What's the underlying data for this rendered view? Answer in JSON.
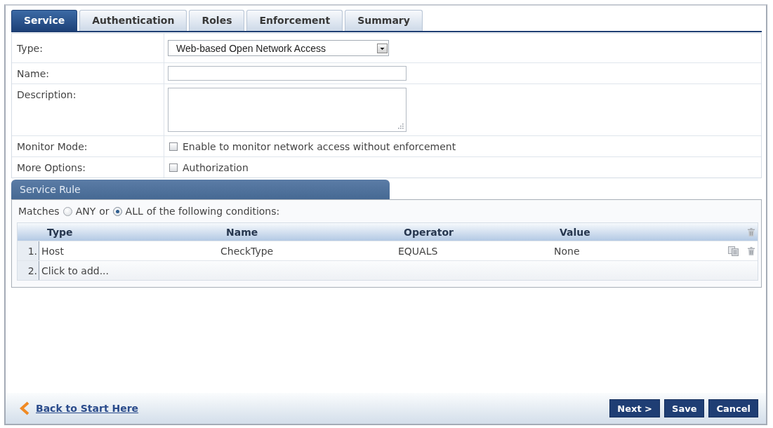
{
  "tabs": [
    {
      "label": "Service",
      "selected": true
    },
    {
      "label": "Authentication",
      "selected": false
    },
    {
      "label": "Roles",
      "selected": false
    },
    {
      "label": "Enforcement",
      "selected": false
    },
    {
      "label": "Summary",
      "selected": false
    }
  ],
  "form": {
    "rows": [
      {
        "kind": "select",
        "label": "Type:",
        "value": "Web-based Open Network Access"
      },
      {
        "kind": "text",
        "label": "Name:"
      },
      {
        "kind": "textarea",
        "label": "Description:"
      },
      {
        "kind": "checkbox",
        "label": "Monitor Mode:",
        "option": "Enable to monitor network access without enforcement",
        "checked": false
      },
      {
        "kind": "checkbox",
        "label": "More Options:",
        "option": "Authorization",
        "checked": false
      }
    ]
  },
  "service_rule": {
    "title": "Service Rule",
    "match_prefix": "Matches",
    "match_options": [
      {
        "label": "ANY",
        "selected": false
      },
      {
        "label": "ALL",
        "selected": true
      }
    ],
    "match_joiner": "or",
    "match_suffix": "of the following conditions:",
    "table": {
      "columns": [
        "Type",
        "Name",
        "Operator",
        "Value"
      ],
      "rows": [
        {
          "number": "1.",
          "cells": [
            "Host",
            "CheckType",
            "EQUALS",
            "None"
          ]
        }
      ],
      "add_row": {
        "number": "2.",
        "label": "Click to add..."
      }
    }
  },
  "footer": {
    "back_link": "Back to Start Here",
    "buttons": [
      "Next >",
      "Save",
      "Cancel"
    ]
  }
}
